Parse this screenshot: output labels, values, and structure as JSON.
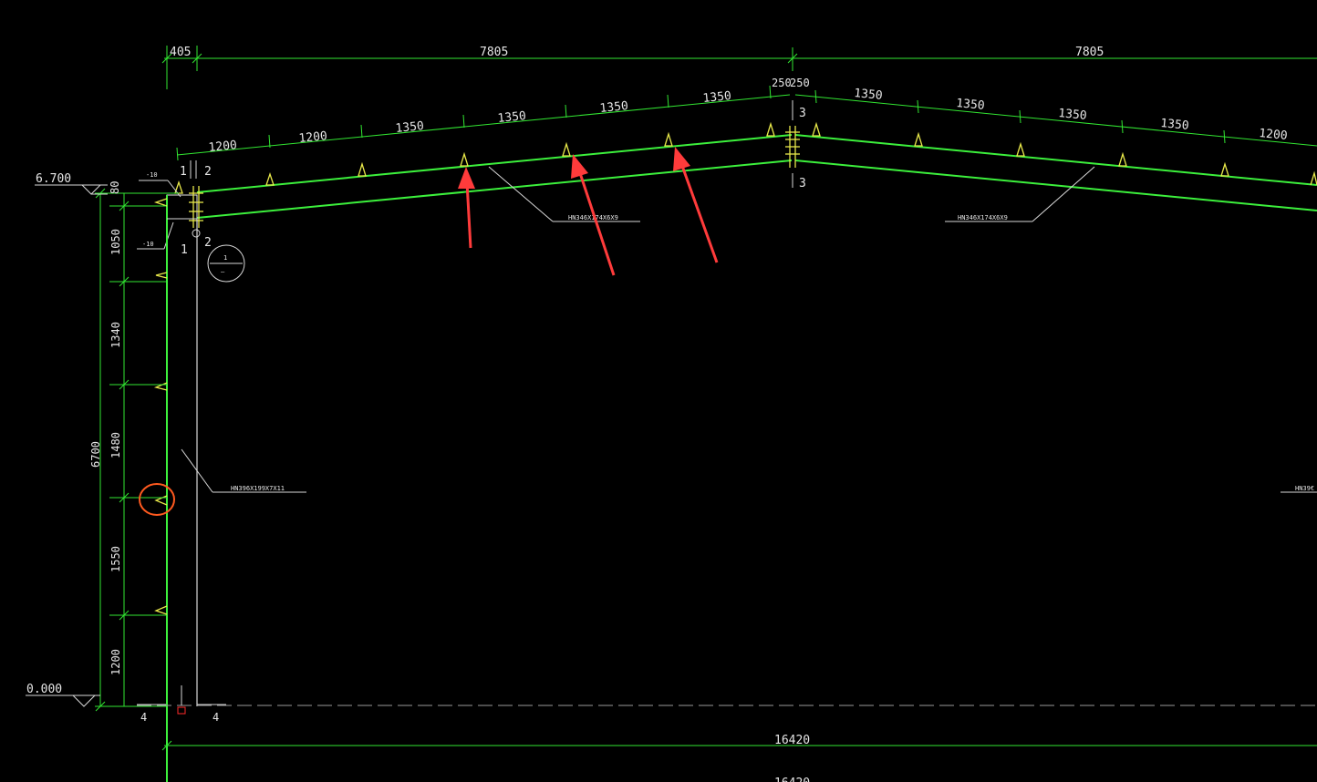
{
  "drawing": {
    "top_dims": [
      "405",
      "7805",
      "7805"
    ],
    "rafter_dims_left": [
      "1200",
      "1200",
      "1350",
      "1350",
      "1350",
      "1350"
    ],
    "ridge_dims": [
      "250",
      "250"
    ],
    "rafter_dims_right": [
      "1350",
      "1350",
      "1350",
      "1350",
      "1200"
    ],
    "column_dims": [
      "80",
      "1050",
      "1340",
      "1480",
      "1550",
      "1200"
    ],
    "total_height": "6700",
    "elev_top": "6.700",
    "elev_bottom": "0.000",
    "bottom_span_1": "16420",
    "bottom_span_2": "16420",
    "base_marks": [
      "4",
      "4"
    ],
    "plate_mark_upper": "-10",
    "plate_mark_lower": "-10",
    "section_marks": [
      "1",
      "2",
      "1",
      "2",
      "3",
      "3"
    ],
    "detail_bubble_top": "1",
    "detail_bubble_bottom": "—",
    "rafter_label_left": "HN346X174X6X9",
    "rafter_label_right": "HN346X174X6X9",
    "column_label": "HN396X199X7X11",
    "column_label_right": "HN39€"
  },
  "annotations": {
    "arrow_color": "#ff3b3b",
    "circle_color": "#ff5a1f"
  }
}
